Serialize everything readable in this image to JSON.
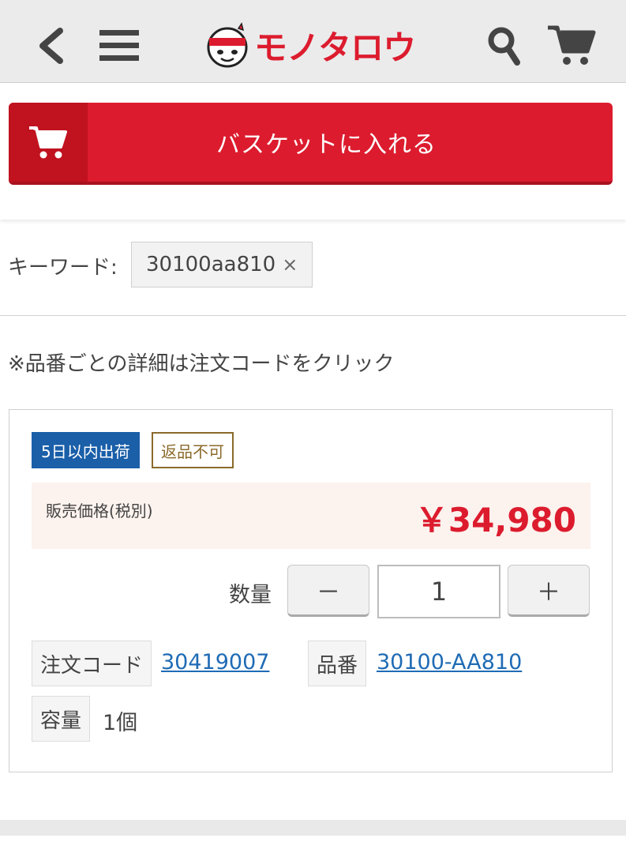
{
  "header": {
    "logo_text": "モノタロウ",
    "brand_color": "#dc1c2e",
    "icons": [
      "back-icon",
      "menu-icon",
      "search-icon",
      "cart-icon"
    ]
  },
  "basket": {
    "label": "バスケットに入れる",
    "icon": "cart-icon"
  },
  "keyword": {
    "label": "キーワード:",
    "value": "30100aa810",
    "remove": "×"
  },
  "note": "※品番ごとの詳細は注文コードをクリック",
  "product": {
    "badge_ship": "5日以内出荷",
    "badge_noreturn": "返品不可",
    "price_label": "販売価格(税別)",
    "price": "￥34,980",
    "quantity_label": "数量",
    "quantity_minus": "－",
    "quantity_plus": "＋",
    "quantity_value": "1",
    "order_code_label": "注文コード",
    "order_code": "30419007",
    "part_no_label": "品番",
    "part_no": "30100-AA810",
    "capacity_label": "容量",
    "capacity": "1個"
  }
}
